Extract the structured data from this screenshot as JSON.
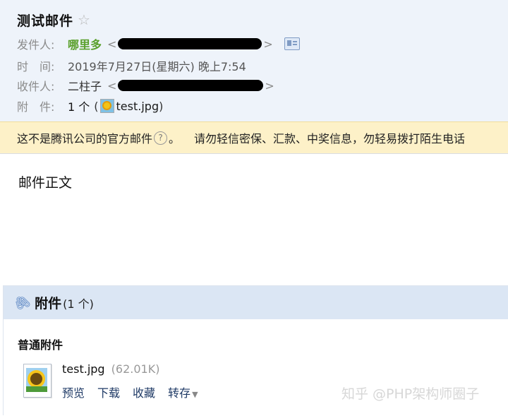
{
  "header": {
    "subject": "测试邮件",
    "sender_label": "发件人:",
    "sender_name": "哪里多",
    "time_label": "时　间:",
    "time_value": "2019年7月27日(星期六) 晚上7:54",
    "recipient_label": "收件人:",
    "recipient_name": "二柱子",
    "attachment_label": "附　件:",
    "attachment_count": "1 个",
    "attachment_file": "test.jpg",
    "open_bracket": "<",
    "close_bracket": ">"
  },
  "warning": {
    "text_before_help": "这不是腾讯公司的官方邮件",
    "help_glyph": "?",
    "after_help": "。",
    "text_after": "请勿轻信密保、汇款、中奖信息，勿轻易拨打陌生电话"
  },
  "body": {
    "content": "邮件正文"
  },
  "attachments": {
    "title": "附件",
    "count_label": "(1 个)",
    "group_title": "普通附件",
    "file": {
      "name": "test.jpg",
      "size": "(62.01K)",
      "actions": {
        "preview": "预览",
        "download": "下载",
        "favorite": "收藏",
        "save": "转存"
      }
    }
  },
  "watermark": "知乎 @PHP架构师圈子",
  "colors": {
    "header_bg": "#eef3fa",
    "warning_bg": "#fdf1c8",
    "sender_green": "#5aa02c",
    "attach_head_bg": "#dbe6f4"
  }
}
